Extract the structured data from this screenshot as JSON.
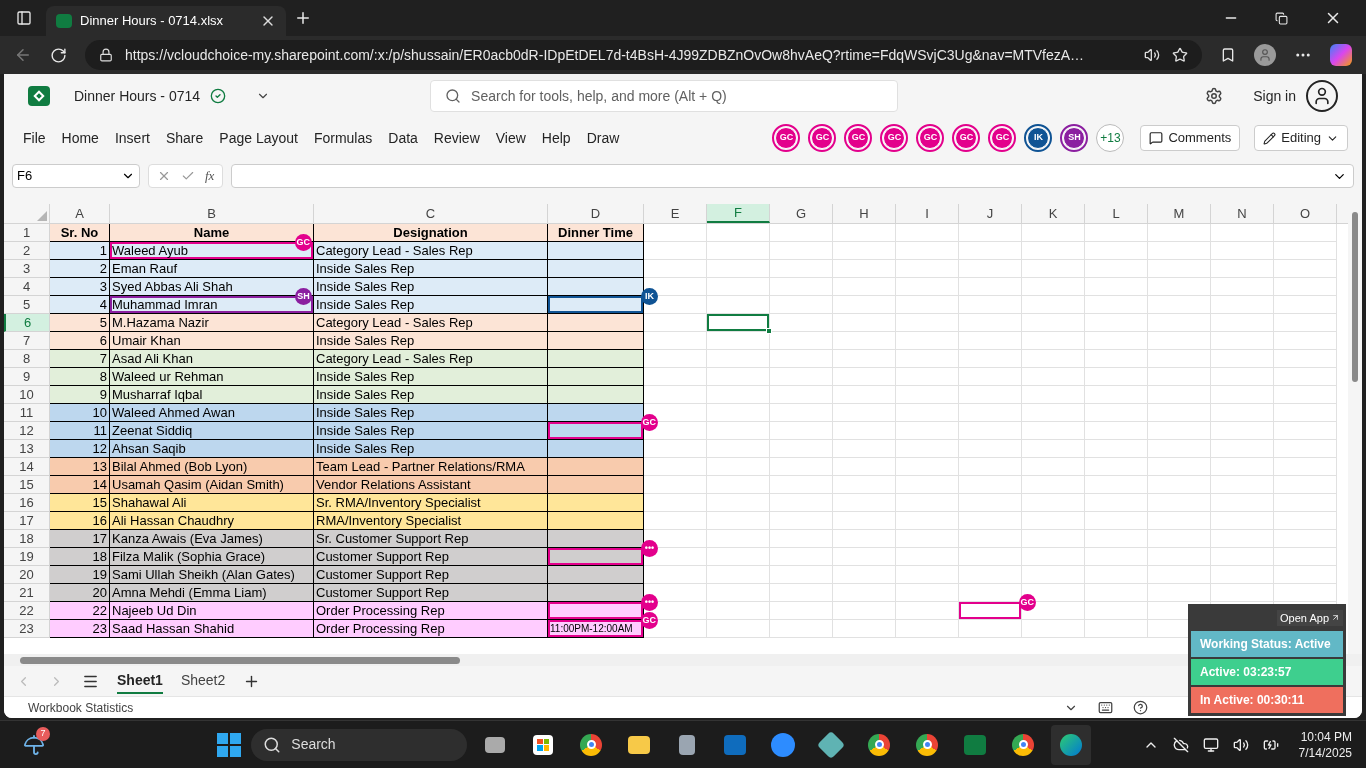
{
  "browser": {
    "tab_title": "Dinner Hours - 0714.xlsx",
    "url": "https://vcloudchoice-my.sharepoint.com/:x:/p/shussain/ER0acb0dR-IDpEtDEL7d-t4BsH-4J99ZDBZnOvOw8hvAeQ?rtime=FdqWSvjC3Ug&nav=MTVfezA…"
  },
  "excel": {
    "title": "Dinner Hours - 0714",
    "search_placeholder": "Search for tools, help, and more (Alt + Q)",
    "sign_in": "Sign in",
    "menu": [
      "File",
      "Home",
      "Insert",
      "Share",
      "Page Layout",
      "Formulas",
      "Data",
      "Review",
      "View",
      "Help",
      "Draw"
    ],
    "collaborators": [
      {
        "label": "GC",
        "color": "#e3008c"
      },
      {
        "label": "GC",
        "color": "#e3008c"
      },
      {
        "label": "GC",
        "color": "#e3008c"
      },
      {
        "label": "GC",
        "color": "#e3008c"
      },
      {
        "label": "GC",
        "color": "#e3008c"
      },
      {
        "label": "GC",
        "color": "#e3008c"
      },
      {
        "label": "GC",
        "color": "#e3008c"
      },
      {
        "label": "IK",
        "color": "#0f5394"
      },
      {
        "label": "SH",
        "color": "#8b1fa0"
      }
    ],
    "more_collaborators": "+13",
    "comments": "Comments",
    "mode": "Editing",
    "name_box": "F6",
    "function_label": "fx"
  },
  "sheet": {
    "columns": [
      {
        "letter": "A",
        "selected": false
      },
      {
        "letter": "B",
        "selected": false
      },
      {
        "letter": "C",
        "selected": false
      },
      {
        "letter": "D",
        "selected": false
      },
      {
        "letter": "E",
        "selected": false
      },
      {
        "letter": "F",
        "selected": true
      },
      {
        "letter": "G",
        "selected": false
      },
      {
        "letter": "H",
        "selected": false
      },
      {
        "letter": "I",
        "selected": false
      },
      {
        "letter": "J",
        "selected": false
      },
      {
        "letter": "K",
        "selected": false
      },
      {
        "letter": "L",
        "selected": false
      },
      {
        "letter": "M",
        "selected": false
      },
      {
        "letter": "N",
        "selected": false
      },
      {
        "letter": "O",
        "selected": false
      }
    ],
    "rows": [
      {
        "number": "1",
        "kind": "header",
        "selected": false,
        "color": "#fce4d6",
        "cells": [
          "Sr. No",
          "Name",
          "Designation",
          "Dinner Time"
        ]
      },
      {
        "number": "2",
        "kind": "data",
        "selected": false,
        "color": "#ddebf7",
        "cells": [
          "1",
          "Waleed Ayub",
          "Category Lead - Sales Rep"
        ],
        "cursors": [
          {
            "label": "GC",
            "color": "#e3008c",
            "kind": "name"
          }
        ]
      },
      {
        "number": "3",
        "kind": "data",
        "selected": false,
        "color": "#ddebf7",
        "cells": [
          "2",
          "Eman Rauf",
          "Inside Sales Rep"
        ]
      },
      {
        "number": "4",
        "kind": "data",
        "selected": false,
        "color": "#ddebf7",
        "cells": [
          "3",
          "Syed Abbas Ali Shah",
          "Inside Sales Rep"
        ]
      },
      {
        "number": "5",
        "kind": "data",
        "selected": false,
        "color": "#ddebf7",
        "cells": [
          "4",
          "Muhammad Imran",
          "Inside Sales Rep"
        ],
        "cursors": [
          {
            "label": "SH",
            "color": "#8b1fa0",
            "kind": "name"
          },
          {
            "label": "IK",
            "color": "#0f5394",
            "kind": "time"
          }
        ]
      },
      {
        "number": "6",
        "kind": "data",
        "selected": true,
        "color": "#fce4d6",
        "cells": [
          "5",
          "M.Hazama Nazir",
          "Category Lead - Sales Rep"
        ]
      },
      {
        "number": "7",
        "kind": "data",
        "selected": false,
        "color": "#fce4d6",
        "cells": [
          "6",
          "Umair Khan",
          "Inside Sales Rep"
        ]
      },
      {
        "number": "8",
        "kind": "data",
        "selected": false,
        "color": "#e2efda",
        "cells": [
          "7",
          "Asad Ali Khan",
          "Category Lead - Sales Rep"
        ]
      },
      {
        "number": "9",
        "kind": "data",
        "selected": false,
        "color": "#e2efda",
        "cells": [
          "8",
          "Waleed ur Rehman",
          "Inside Sales Rep"
        ]
      },
      {
        "number": "10",
        "kind": "data",
        "selected": false,
        "color": "#e2efda",
        "cells": [
          "9",
          "Musharraf Iqbal",
          "Inside Sales Rep"
        ]
      },
      {
        "number": "11",
        "kind": "data",
        "selected": false,
        "color": "#bdd7ee",
        "cells": [
          "10",
          "Waleed Ahmed Awan",
          "Inside Sales Rep"
        ]
      },
      {
        "number": "12",
        "kind": "data",
        "selected": false,
        "color": "#bdd7ee",
        "cells": [
          "11",
          "Zeenat Siddiq",
          "Inside Sales Rep"
        ],
        "cursors": [
          {
            "label": "GC",
            "color": "#e3008c",
            "kind": "time"
          }
        ]
      },
      {
        "number": "13",
        "kind": "data",
        "selected": false,
        "color": "#bdd7ee",
        "cells": [
          "12",
          "Ahsan Saqib",
          "Inside Sales Rep"
        ]
      },
      {
        "number": "14",
        "kind": "data",
        "selected": false,
        "color": "#f8cbad",
        "cells": [
          "13",
          "Bilal Ahmed (Bob Lyon)",
          "Team Lead - Partner Relations/RMA"
        ]
      },
      {
        "number": "15",
        "kind": "data",
        "selected": false,
        "color": "#f8cbad",
        "cells": [
          "14",
          "Usamah Qasim (Aidan Smith)",
          "Vendor Relations Assistant"
        ]
      },
      {
        "number": "16",
        "kind": "data",
        "selected": false,
        "color": "#ffe699",
        "cells": [
          "15",
          "Shahawal Ali",
          "Sr. RMA/Inventory Specialist"
        ]
      },
      {
        "number": "17",
        "kind": "data",
        "selected": false,
        "color": "#ffe699",
        "cells": [
          "16",
          "Ali Hassan Chaudhry",
          "RMA/Inventory Specialist"
        ]
      },
      {
        "number": "18",
        "kind": "data",
        "selected": false,
        "color": "#d0cece",
        "cells": [
          "17",
          "Kanza Awais (Eva James)",
          "Sr. Customer Support Rep"
        ]
      },
      {
        "number": "19",
        "kind": "data",
        "selected": false,
        "color": "#d0cece",
        "cells": [
          "18",
          "Filza Malik (Sophia Grace)",
          "Customer Support Rep"
        ],
        "cursors": [
          {
            "label": "•••",
            "color": "#e3008c",
            "kind": "time"
          }
        ]
      },
      {
        "number": "20",
        "kind": "data",
        "selected": false,
        "color": "#d0cece",
        "cells": [
          "19",
          "Sami Ullah Sheikh (Alan Gates)",
          "Customer Support Rep"
        ]
      },
      {
        "number": "21",
        "kind": "data",
        "selected": false,
        "color": "#d0cece",
        "cells": [
          "20",
          "Amna Mehdi (Emma Liam)",
          "Customer Support Rep"
        ]
      },
      {
        "number": "22",
        "kind": "data",
        "selected": false,
        "color": "#ffccff",
        "cells": [
          "22",
          "Najeeb Ud Din",
          "Order Processing Rep"
        ],
        "cursors": [
          {
            "label": "•••",
            "color": "#e3008c",
            "kind": "time"
          },
          {
            "label": "GC",
            "color": "#e3008c",
            "kind": "far"
          }
        ]
      },
      {
        "number": "23",
        "kind": "data",
        "selected": false,
        "color": "#ffccff",
        "cells": [
          "23",
          "Saad Hassan Shahid",
          "Order Processing Rep",
          "11:00PM-12:00AM"
        ],
        "cursors": [
          {
            "label": "GC",
            "color": "#e3008c",
            "kind": "time"
          }
        ]
      }
    ]
  },
  "sheet_tabs": [
    {
      "label": "Sheet1",
      "selected": true
    },
    {
      "label": "Sheet2",
      "selected": false
    }
  ],
  "status_bar": "Workbook Statistics",
  "tracker": {
    "open_app": "Open App",
    "working_status": "Working Status: Active",
    "active": "Active: 03:23:57",
    "inactive": "In Active: 00:30:11"
  },
  "taskbar": {
    "weather_badge": "7",
    "search": "Search",
    "time": "10:04 PM",
    "date": "7/14/2025"
  }
}
